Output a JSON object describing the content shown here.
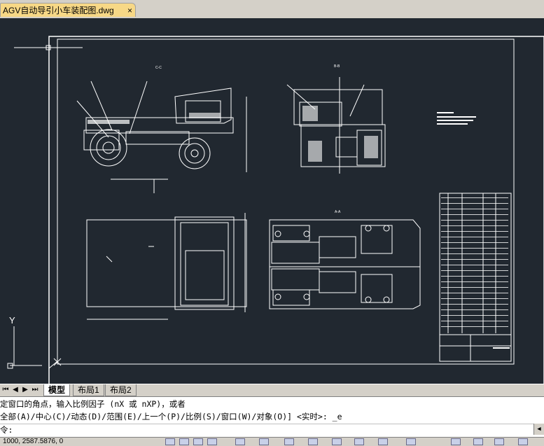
{
  "doc_tab": {
    "title": "AGV自动导引小车装配图.dwg",
    "close_glyph": "×"
  },
  "layout_nav": {
    "first": "⏮",
    "prev": "◀",
    "next": "▶",
    "last": "⏭"
  },
  "layout_tabs": [
    {
      "label": "模型",
      "active": true
    },
    {
      "label": "布局1",
      "active": false
    },
    {
      "label": "布局2",
      "active": false
    }
  ],
  "drawing": {
    "ucs_y_label": "Y",
    "view_labels": [
      "C-C",
      "B-B",
      "A-A"
    ]
  },
  "command": {
    "line1": "定窗口的角点，输入比例因子 (nX 或 nXP)，或者",
    "line2": "全部(A)/中心(C)/动态(D)/范围(E)/上一个(P)/比例(S)/窗口(W)/对象(O)] <实时>: _e",
    "prompt": "令:",
    "scroll_glyph": "◀"
  },
  "status": {
    "coords": "1000, 2587.5876, 0"
  },
  "colors": {
    "canvas_bg": "#212830",
    "line": "#ffffff",
    "tab_bg": "#f7d886"
  }
}
